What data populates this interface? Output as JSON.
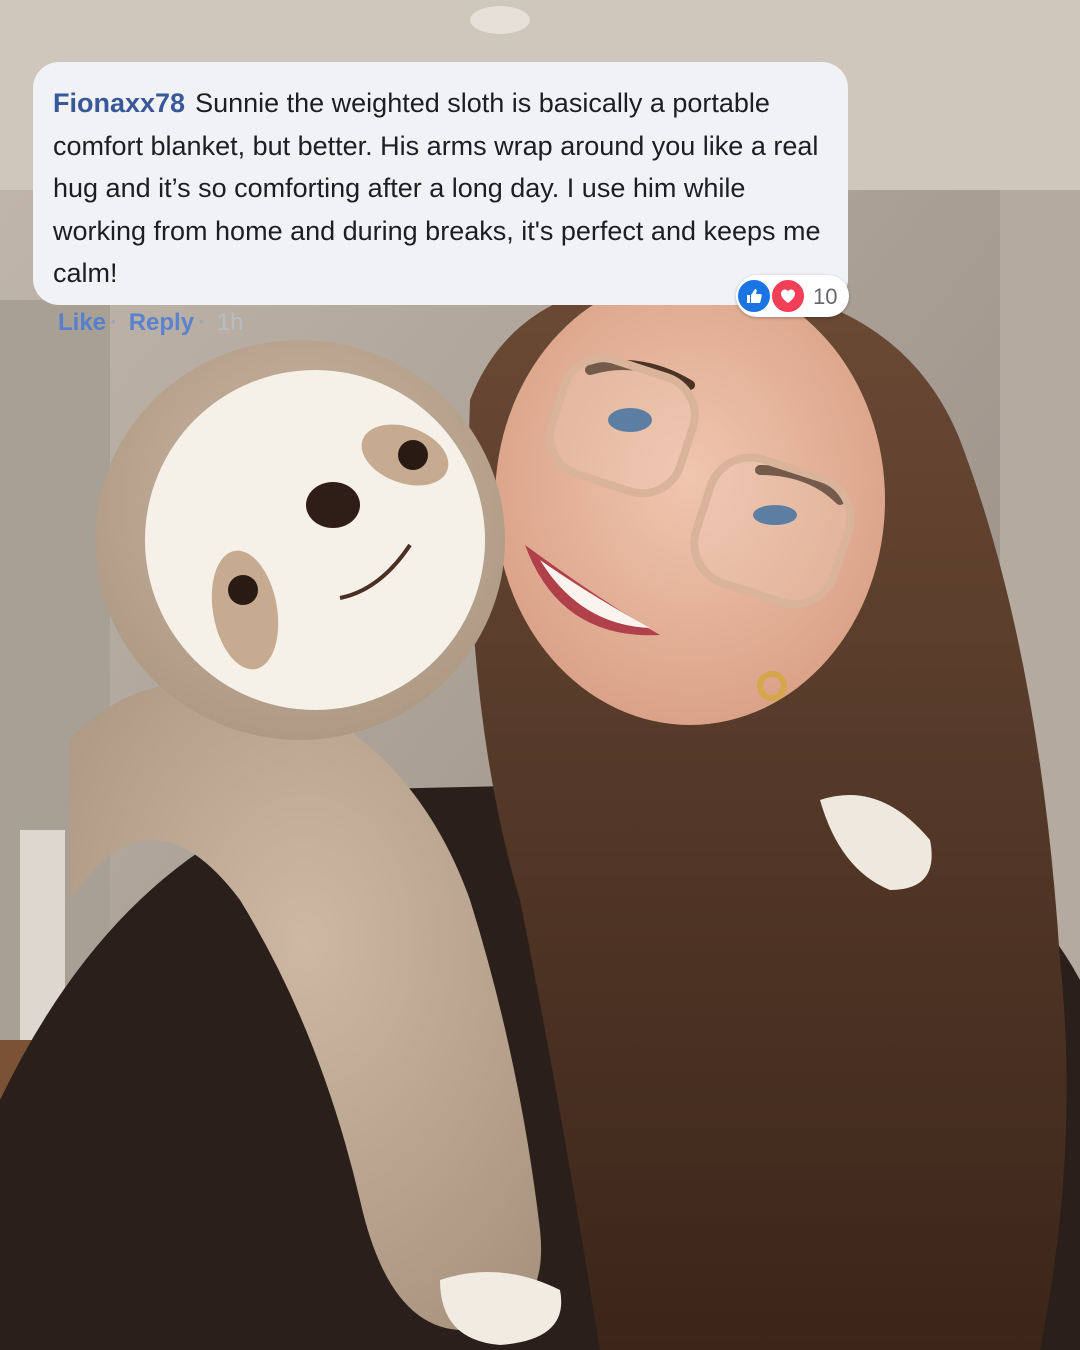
{
  "comment": {
    "author": "Fionaxx78",
    "text": "Sunnie the weighted sloth is basically a portable comfort blanket, but better. His arms wrap around you like a real hug and it’s so comforting after a long day. I use him while working from home and during breaks, it's perfect and keeps me calm!",
    "reaction_count": "10",
    "reaction_icons": [
      "like-icon",
      "love-icon"
    ],
    "actions": {
      "like": "Like",
      "reply": "Reply",
      "separator": "·",
      "time": "1h"
    },
    "colors": {
      "author": "#385898",
      "bubble": "#f0f2f5",
      "like": "#1b74e4",
      "love": "#f33e58"
    }
  }
}
